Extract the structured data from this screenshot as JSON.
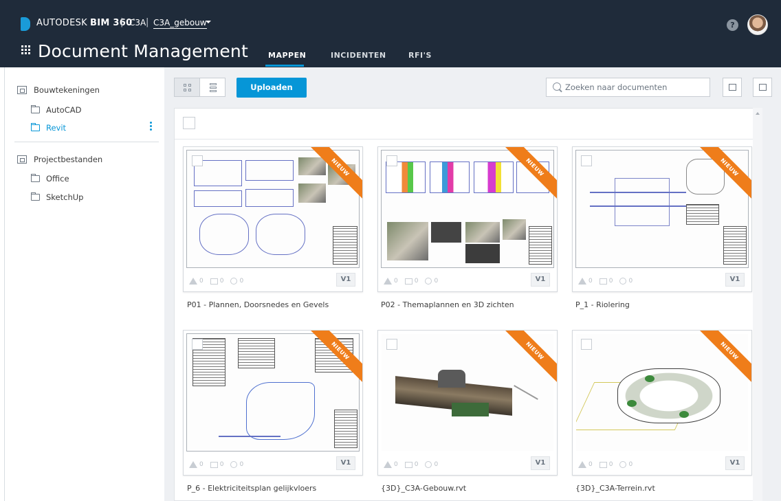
{
  "header": {
    "brand_autodesk": "AUTODESK",
    "brand_bim": "BIM 360",
    "brand_reg": "°",
    "project": "C3A",
    "folder_selector": "C3A_gebouw",
    "help": "?",
    "app_title": "Document Management",
    "tabs": [
      {
        "label": "MAPPEN",
        "active": true
      },
      {
        "label": "INCIDENTEN",
        "active": false
      },
      {
        "label": "RFI'S",
        "active": false
      }
    ]
  },
  "sidebar": {
    "sections": [
      {
        "label": "Bouwtekeningen",
        "children": [
          {
            "label": "AutoCAD",
            "selected": false
          },
          {
            "label": "Revit",
            "selected": true
          }
        ]
      },
      {
        "label": "Projectbestanden",
        "children": [
          {
            "label": "Office",
            "selected": false
          },
          {
            "label": "SketchUp",
            "selected": false
          }
        ]
      }
    ]
  },
  "toolbar": {
    "upload_label": "Uploaden",
    "search_placeholder": "Zoeken naar documenten"
  },
  "documents": [
    {
      "name": "P01 - Plannen, Doorsnedes en Gevels",
      "badge": "NIEUW",
      "version": "V1",
      "issues": "0",
      "markups": "0",
      "approvals": "0"
    },
    {
      "name": "P02 - Themaplannen en 3D zichten",
      "badge": "NIEUW",
      "version": "V1",
      "issues": "0",
      "markups": "0",
      "approvals": "0"
    },
    {
      "name": "P_1 - Riolering",
      "badge": "NIEUW",
      "version": "V1",
      "issues": "0",
      "markups": "0",
      "approvals": "0"
    },
    {
      "name": "P_6 - Elektriciteitsplan gelijkvloers",
      "badge": "NIEUW",
      "version": "V1",
      "issues": "0",
      "markups": "0",
      "approvals": "0"
    },
    {
      "name": "{3D}_C3A-Gebouw.rvt",
      "badge": "NIEUW",
      "version": "V1",
      "issues": "0",
      "markups": "0",
      "approvals": "0"
    },
    {
      "name": "{3D}_C3A-Terrein.rvt",
      "badge": "NIEUW",
      "version": "V1",
      "issues": "0",
      "markups": "0",
      "approvals": "0"
    }
  ],
  "colors": {
    "header_bg": "#1f2b3a",
    "accent": "#0696d7",
    "badge": "#ef7d1a"
  }
}
